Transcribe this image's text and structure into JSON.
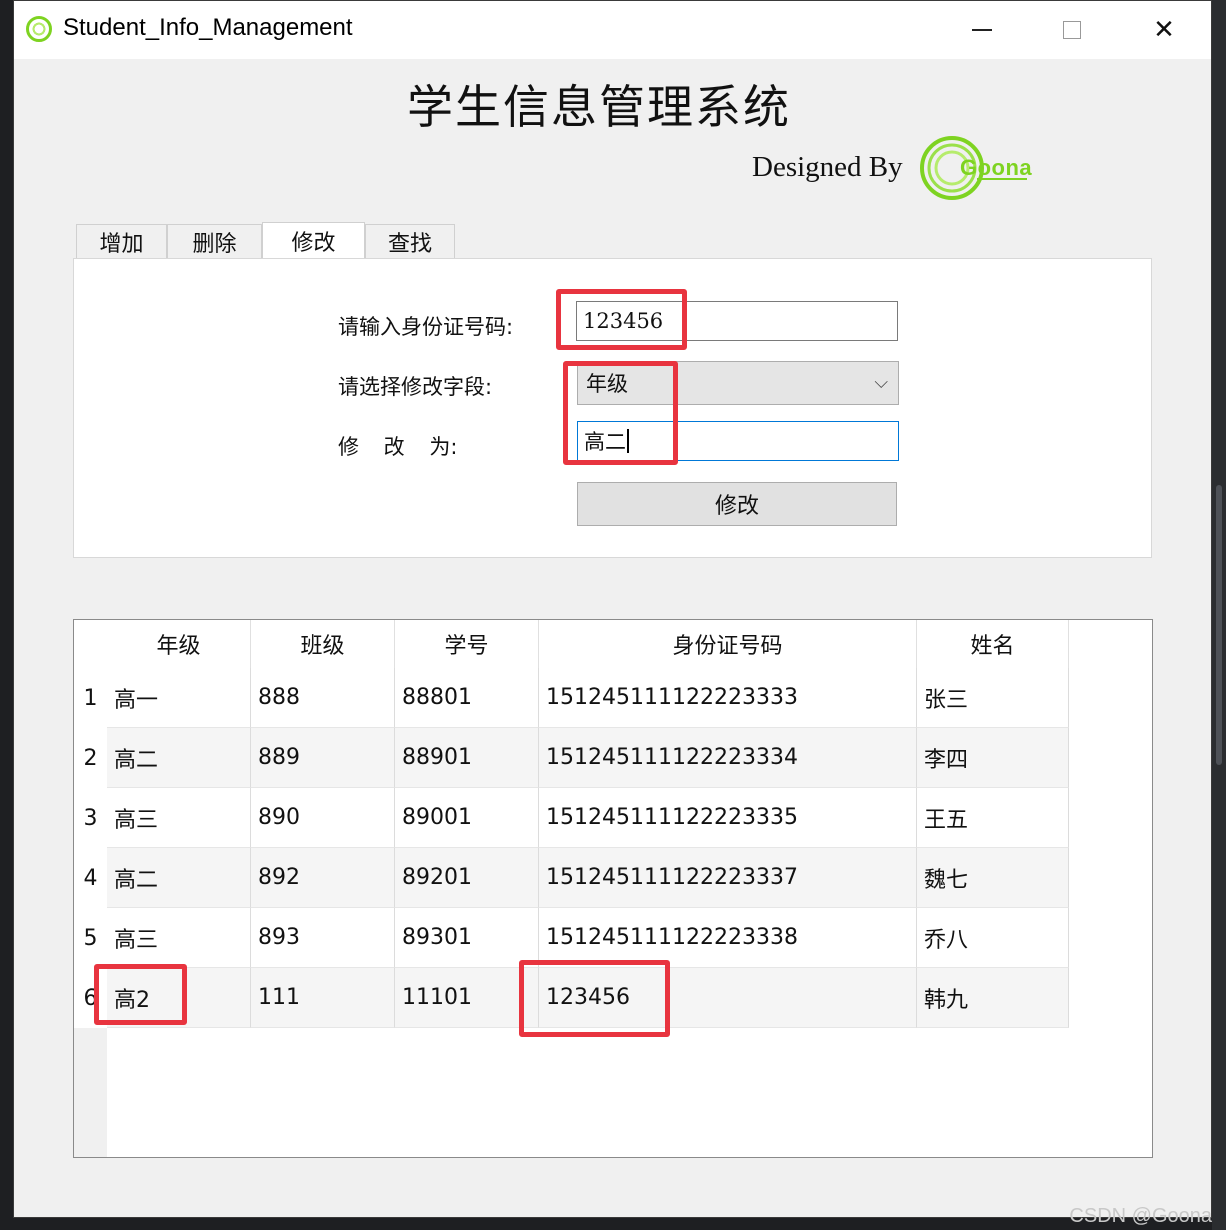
{
  "window": {
    "title": "Student_Info_Management",
    "minimize_glyph": "—",
    "close_glyph": "✕"
  },
  "header": {
    "title": "学生信息管理系统",
    "designed_by": "Designed By",
    "logo_text": "Goona"
  },
  "tabs": [
    {
      "label": "增加"
    },
    {
      "label": "删除"
    },
    {
      "label": "修改",
      "active": true
    },
    {
      "label": "查找"
    }
  ],
  "form": {
    "id_label": "请输入身份证号码:",
    "id_value": "123456",
    "field_label": "请选择修改字段:",
    "field_value": "年级",
    "modify_to_label": "修 改 为:",
    "modify_to_value": "高二",
    "submit_label": "修改"
  },
  "table": {
    "columns": [
      "年级",
      "班级",
      "学号",
      "身份证号码",
      "姓名"
    ],
    "rows": [
      {
        "num": "1",
        "cells": [
          "高一",
          "888",
          "88801",
          "151245111122223333",
          "张三"
        ]
      },
      {
        "num": "2",
        "cells": [
          "高二",
          "889",
          "88901",
          "151245111122223334",
          "李四"
        ]
      },
      {
        "num": "3",
        "cells": [
          "高三",
          "890",
          "89001",
          "151245111122223335",
          "王五"
        ]
      },
      {
        "num": "4",
        "cells": [
          "高二",
          "892",
          "89201",
          "151245111122223337",
          "魏七"
        ]
      },
      {
        "num": "5",
        "cells": [
          "高三",
          "893",
          "89301",
          "151245111122223338",
          "乔八"
        ]
      },
      {
        "num": "6",
        "cells": [
          "高2",
          "111",
          "11101",
          "123456",
          "韩九"
        ]
      }
    ]
  },
  "watermark": "CSDN @Goona",
  "colors": {
    "highlight": "#e8343f",
    "brand": "#7ed321",
    "focus_border": "#0078d7"
  }
}
